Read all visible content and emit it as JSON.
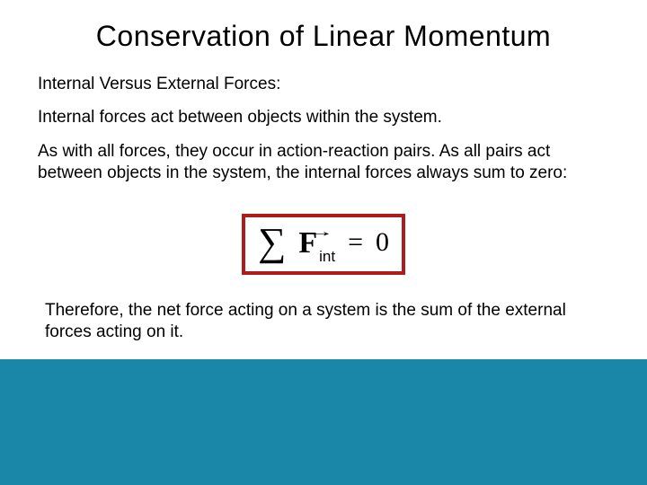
{
  "slide": {
    "title": "Conservation of Linear Momentum",
    "subtitle": "Internal Versus External Forces:",
    "para1": "Internal forces act between objects within the system.",
    "para2": "As with all forces, they occur in action-reaction pairs. As all pairs act between objects in the system, the internal forces always sum to zero:",
    "equation": {
      "sigma": "∑",
      "arrow": "→",
      "var": "F",
      "sub": "int",
      "eq": "=",
      "rhs": "0"
    },
    "conclusion": "Therefore, the net force acting on a system is the sum of the external forces acting on it."
  },
  "colors": {
    "background": "#1a87a8",
    "equation_border": "#b01c1c",
    "text": "#000000"
  }
}
